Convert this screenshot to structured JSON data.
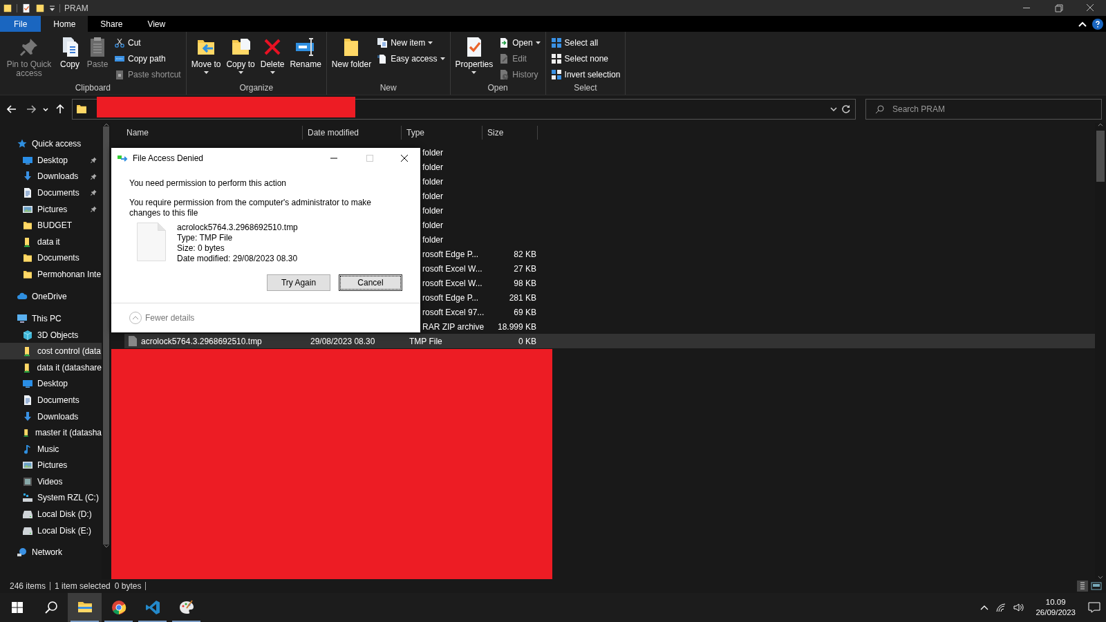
{
  "window": {
    "title": "PRAM"
  },
  "ribbon": {
    "tabs": [
      {
        "label": "File",
        "kind": "file",
        "selected": false
      },
      {
        "label": "Home",
        "kind": "tab",
        "selected": true
      },
      {
        "label": "Share",
        "kind": "tab",
        "selected": false
      },
      {
        "label": "View",
        "kind": "tab",
        "selected": false
      }
    ],
    "groups": [
      {
        "label": "Clipboard",
        "items": [
          {
            "label": "Pin to Quick access",
            "kind": "pin",
            "disabled": true,
            "dropdown": false
          },
          {
            "label": "Copy",
            "kind": "copy",
            "disabled": false,
            "dropdown": false
          },
          {
            "label": "Paste",
            "kind": "paste",
            "disabled": true,
            "dropdown": false
          },
          {
            "label": "Cut",
            "kind": "cut",
            "disabled": false,
            "dropdown": false
          },
          {
            "label": "Copy path",
            "kind": "copypath",
            "disabled": false,
            "dropdown": false
          },
          {
            "label": "Paste shortcut",
            "kind": "pasteshortcut",
            "disabled": true,
            "dropdown": false
          }
        ]
      },
      {
        "label": "Organize",
        "items": [
          {
            "label": "Move to",
            "kind": "moveto",
            "disabled": false,
            "dropdown": true
          },
          {
            "label": "Copy to",
            "kind": "copyto",
            "disabled": false,
            "dropdown": true
          },
          {
            "label": "Delete",
            "kind": "delete",
            "disabled": false,
            "dropdown": true
          },
          {
            "label": "Rename",
            "kind": "rename",
            "disabled": false,
            "dropdown": false
          }
        ]
      },
      {
        "label": "New",
        "items": [
          {
            "label": "New folder",
            "kind": "newfolder",
            "disabled": false,
            "dropdown": false
          },
          {
            "label": "New item",
            "kind": "newitem",
            "disabled": false,
            "dropdown": true
          },
          {
            "label": "Easy access",
            "kind": "easyaccess",
            "disabled": false,
            "dropdown": true
          }
        ]
      },
      {
        "label": "Open",
        "items": [
          {
            "label": "Properties",
            "kind": "properties",
            "disabled": false,
            "dropdown": true
          },
          {
            "label": "Open",
            "kind": "open",
            "disabled": false,
            "dropdown": true
          },
          {
            "label": "Edit",
            "kind": "edit",
            "disabled": true,
            "dropdown": false
          },
          {
            "label": "History",
            "kind": "history",
            "disabled": true,
            "dropdown": false
          }
        ]
      },
      {
        "label": "Select",
        "items": [
          {
            "label": "Select all",
            "kind": "selectall",
            "disabled": false,
            "dropdown": false
          },
          {
            "label": "Select none",
            "kind": "selectnone",
            "disabled": false,
            "dropdown": false
          },
          {
            "label": "Invert selection",
            "kind": "invert",
            "disabled": false,
            "dropdown": false
          }
        ]
      }
    ]
  },
  "search": {
    "placeholder": "Search PRAM"
  },
  "sidebar": {
    "sections": [
      {
        "label": "Quick access",
        "kind": "star",
        "children": [
          {
            "label": "Desktop",
            "kind": "desktop",
            "pinned": true,
            "selected": false
          },
          {
            "label": "Downloads",
            "kind": "download",
            "pinned": true,
            "selected": false
          },
          {
            "label": "Documents",
            "kind": "document",
            "pinned": true,
            "selected": false
          },
          {
            "label": "Pictures",
            "kind": "picture",
            "pinned": true,
            "selected": false
          },
          {
            "label": "BUDGET",
            "kind": "folder",
            "pinned": false,
            "selected": false
          },
          {
            "label": "data it",
            "kind": "share",
            "pinned": false,
            "selected": false
          },
          {
            "label": "Documents",
            "kind": "folder",
            "pinned": false,
            "selected": false
          },
          {
            "label": "Permohonan Inte",
            "kind": "folder",
            "pinned": false,
            "selected": false
          }
        ]
      },
      {
        "label": "OneDrive",
        "kind": "cloud"
      },
      {
        "label": "This PC",
        "kind": "pc",
        "children": [
          {
            "label": "3D Objects",
            "kind": "cube",
            "pinned": false,
            "selected": false
          },
          {
            "label": "cost control (data",
            "kind": "share",
            "pinned": false,
            "selected": true
          },
          {
            "label": "data it (datashare",
            "kind": "share",
            "pinned": false,
            "selected": false
          },
          {
            "label": "Desktop",
            "kind": "desktop",
            "pinned": false,
            "selected": false
          },
          {
            "label": "Documents",
            "kind": "document",
            "pinned": false,
            "selected": false
          },
          {
            "label": "Downloads",
            "kind": "download",
            "pinned": false,
            "selected": false
          },
          {
            "label": "master it (datasha",
            "kind": "share",
            "pinned": false,
            "selected": false
          },
          {
            "label": "Music",
            "kind": "music",
            "pinned": false,
            "selected": false
          },
          {
            "label": "Pictures",
            "kind": "picture",
            "pinned": false,
            "selected": false
          },
          {
            "label": "Videos",
            "kind": "video",
            "pinned": false,
            "selected": false
          },
          {
            "label": "System RZL (C:)",
            "kind": "sysdrive",
            "pinned": false,
            "selected": false
          },
          {
            "label": "Local Disk (D:)",
            "kind": "drive",
            "pinned": false,
            "selected": false
          },
          {
            "label": "Local Disk (E:)",
            "kind": "drive",
            "pinned": false,
            "selected": false
          }
        ]
      },
      {
        "label": "Network",
        "kind": "network"
      }
    ]
  },
  "file_list": {
    "columns": [
      "Name",
      "Date modified",
      "Type",
      "Size"
    ],
    "rows": [
      {
        "name": "",
        "date": "",
        "type": "folder",
        "size": "",
        "selected": false
      },
      {
        "name": "",
        "date": "",
        "type": "folder",
        "size": "",
        "selected": false
      },
      {
        "name": "",
        "date": "",
        "type": "folder",
        "size": "",
        "selected": false
      },
      {
        "name": "",
        "date": "",
        "type": "folder",
        "size": "",
        "selected": false
      },
      {
        "name": "",
        "date": "",
        "type": "folder",
        "size": "",
        "selected": false
      },
      {
        "name": "",
        "date": "",
        "type": "folder",
        "size": "",
        "selected": false
      },
      {
        "name": "",
        "date": "",
        "type": "folder",
        "size": "",
        "selected": false
      },
      {
        "name": "",
        "date": "",
        "type": "rosoft Edge P...",
        "size": "82 KB",
        "selected": false
      },
      {
        "name": "",
        "date": "",
        "type": "rosoft Excel W...",
        "size": "27 KB",
        "selected": false
      },
      {
        "name": "",
        "date": "",
        "type": "rosoft Excel W...",
        "size": "98 KB",
        "selected": false
      },
      {
        "name": "",
        "date": "",
        "type": "rosoft Edge P...",
        "size": "281 KB",
        "selected": false
      },
      {
        "name": "",
        "date": "",
        "type": "rosoft Excel 97...",
        "size": "69 KB",
        "selected": false
      },
      {
        "name": "",
        "date": "",
        "type": "RAR ZIP archive",
        "size": "18.999 KB",
        "selected": false
      },
      {
        "name": "acrolock5764.3.2968692510.tmp",
        "date": "29/08/2023 08.30",
        "type": "TMP File",
        "size": "0 KB",
        "selected": true
      }
    ]
  },
  "dialog": {
    "title": "File Access Denied",
    "heading": "You need permission to perform this action",
    "message": "You require permission from the computer's administrator to make changes to this file",
    "file": {
      "name": "acrolock5764.3.2968692510.tmp",
      "type": "Type: TMP File",
      "size": "Size: 0 bytes",
      "date": "Date modified: 29/08/2023 08.30"
    },
    "buttons": [
      {
        "label": "Try Again",
        "focused": false
      },
      {
        "label": "Cancel",
        "focused": true
      }
    ],
    "details_toggle": "Fewer details"
  },
  "status_bar": {
    "count": "246 items",
    "selection": "1 item selected",
    "size": "0 bytes"
  },
  "taskbar": {
    "apps": [
      {
        "kind": "explorer",
        "selected": true
      },
      {
        "kind": "chrome",
        "selected": false
      },
      {
        "kind": "vscode",
        "selected": false
      },
      {
        "kind": "paint",
        "selected": false
      }
    ],
    "time": "10.09",
    "date": "26/09/2023"
  }
}
